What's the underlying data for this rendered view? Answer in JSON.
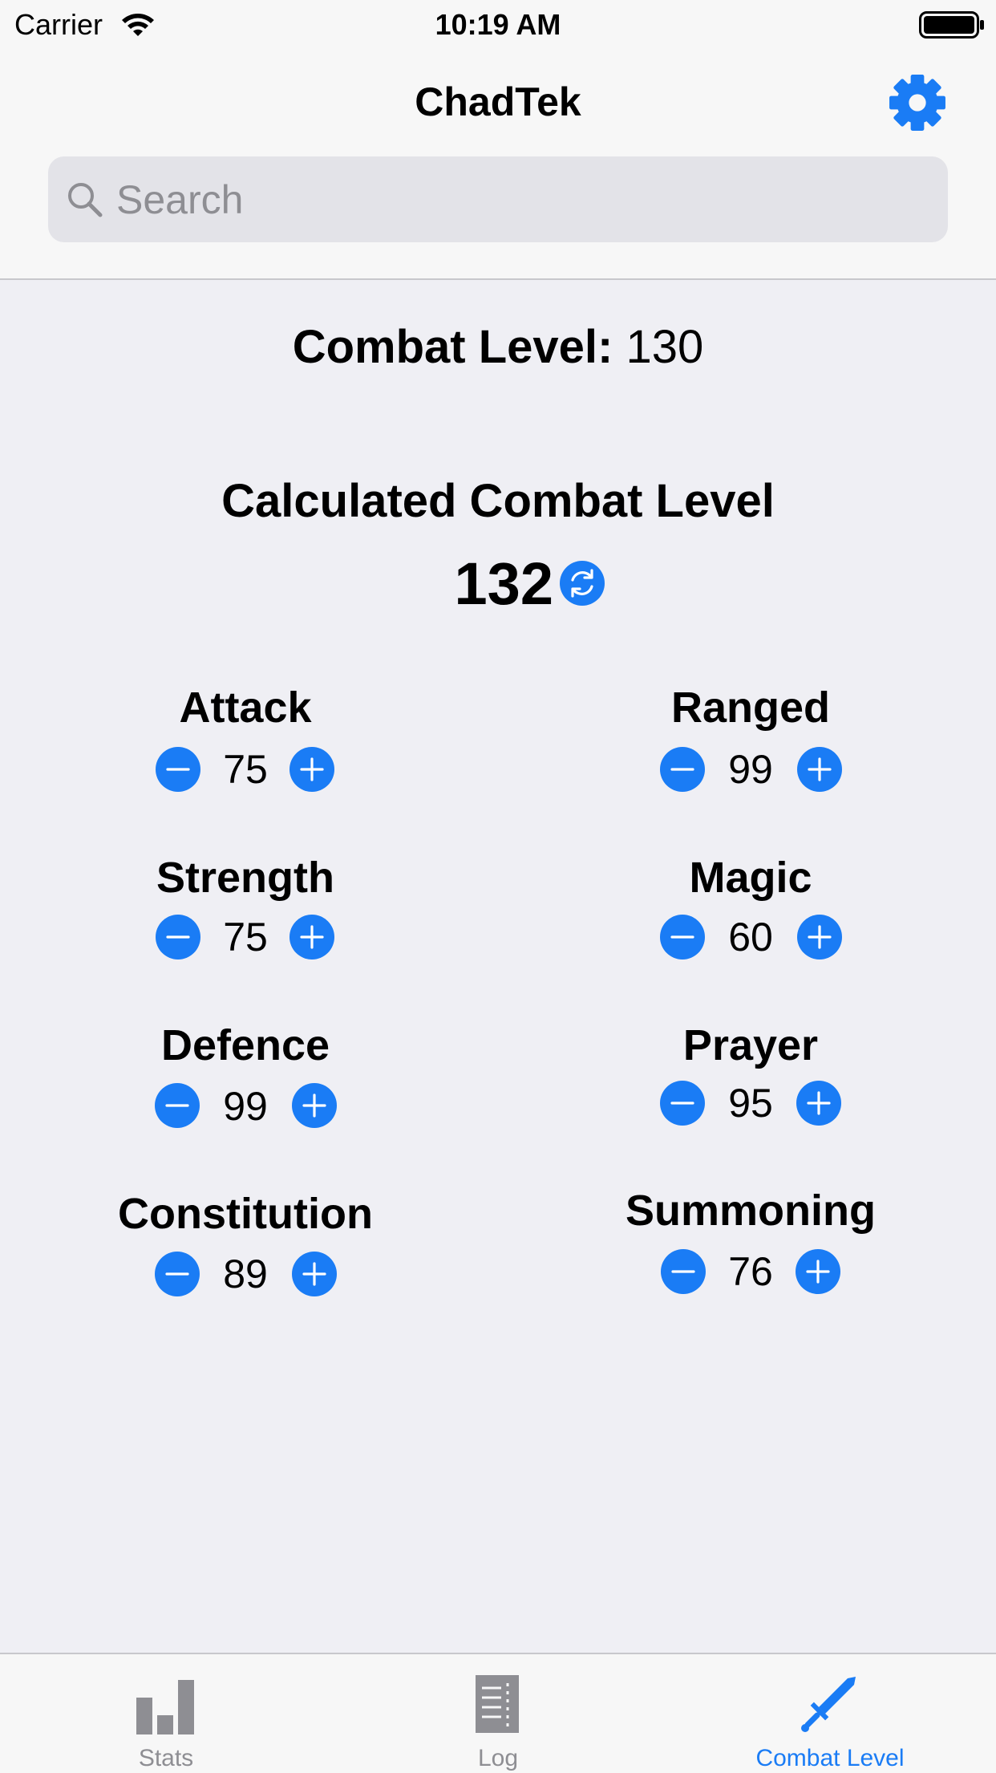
{
  "status_bar": {
    "carrier": "Carrier",
    "time": "10:19 AM"
  },
  "nav": {
    "title": "ChadTek",
    "settings_icon": "gear-icon"
  },
  "search": {
    "placeholder": "Search",
    "value": ""
  },
  "combat": {
    "current_label": "Combat Level:",
    "current_value": "130",
    "calculated_title": "Calculated Combat Level",
    "calculated_value": "132"
  },
  "stats": [
    {
      "name": "Attack",
      "value": "75"
    },
    {
      "name": "Strength",
      "value": "75"
    },
    {
      "name": "Defence",
      "value": "99"
    },
    {
      "name": "Constitution",
      "value": "89"
    },
    {
      "name": "Ranged",
      "value": "99"
    },
    {
      "name": "Magic",
      "value": "60"
    },
    {
      "name": "Prayer",
      "value": "95"
    },
    {
      "name": "Summoning",
      "value": "76"
    }
  ],
  "tabs": [
    {
      "label": "Stats",
      "icon": "bar-chart-icon",
      "selected": false
    },
    {
      "label": "Log",
      "icon": "log-icon",
      "selected": false
    },
    {
      "label": "Combat Level",
      "icon": "sword-icon",
      "selected": true
    }
  ],
  "colors": {
    "accent": "#1a7cf5",
    "inactive": "#8e8e93",
    "background": "#efeff4"
  }
}
